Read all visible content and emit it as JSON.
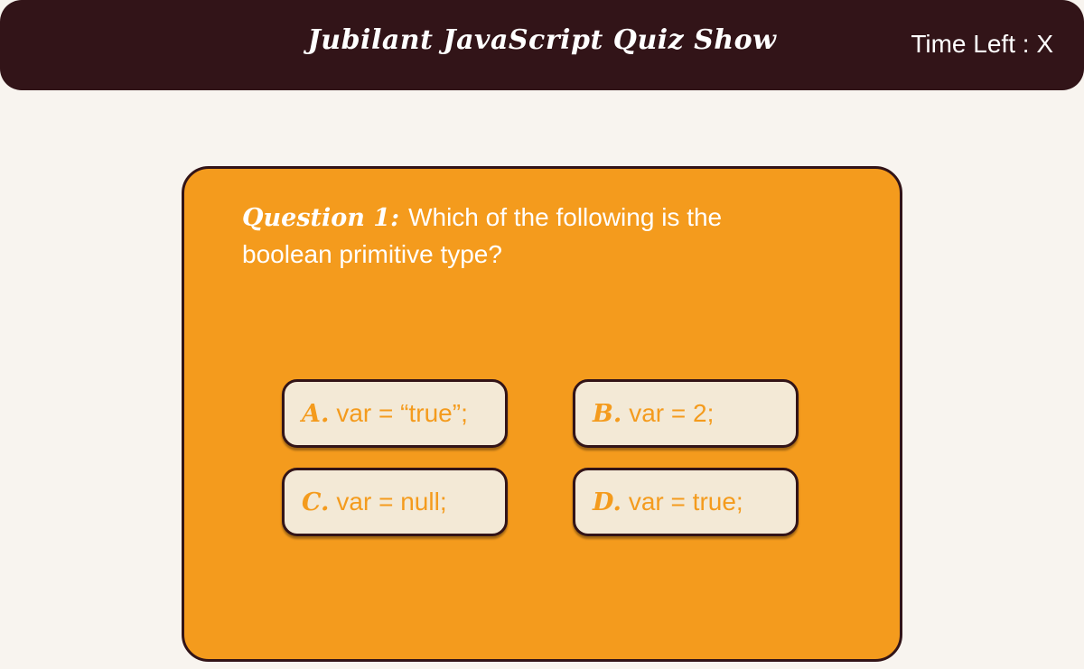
{
  "header": {
    "title": "Jubilant JavaScript Quiz Show",
    "timer_label": "Time Left : X"
  },
  "question": {
    "label": "Question 1:",
    "text": "Which of the following is the boolean primitive type?"
  },
  "answers": [
    {
      "letter": "A.",
      "text": "var = “true”;"
    },
    {
      "letter": "B.",
      "text": "var = 2;"
    },
    {
      "letter": "C.",
      "text": "var = null;"
    },
    {
      "letter": "D.",
      "text": "var = true;"
    }
  ],
  "colors": {
    "header_bg": "#321418",
    "page_bg": "#f8f4ef",
    "card_bg": "#f49b1d",
    "answer_bg": "#f3e9d6",
    "accent_text": "#f49b1d",
    "border": "#321418"
  }
}
